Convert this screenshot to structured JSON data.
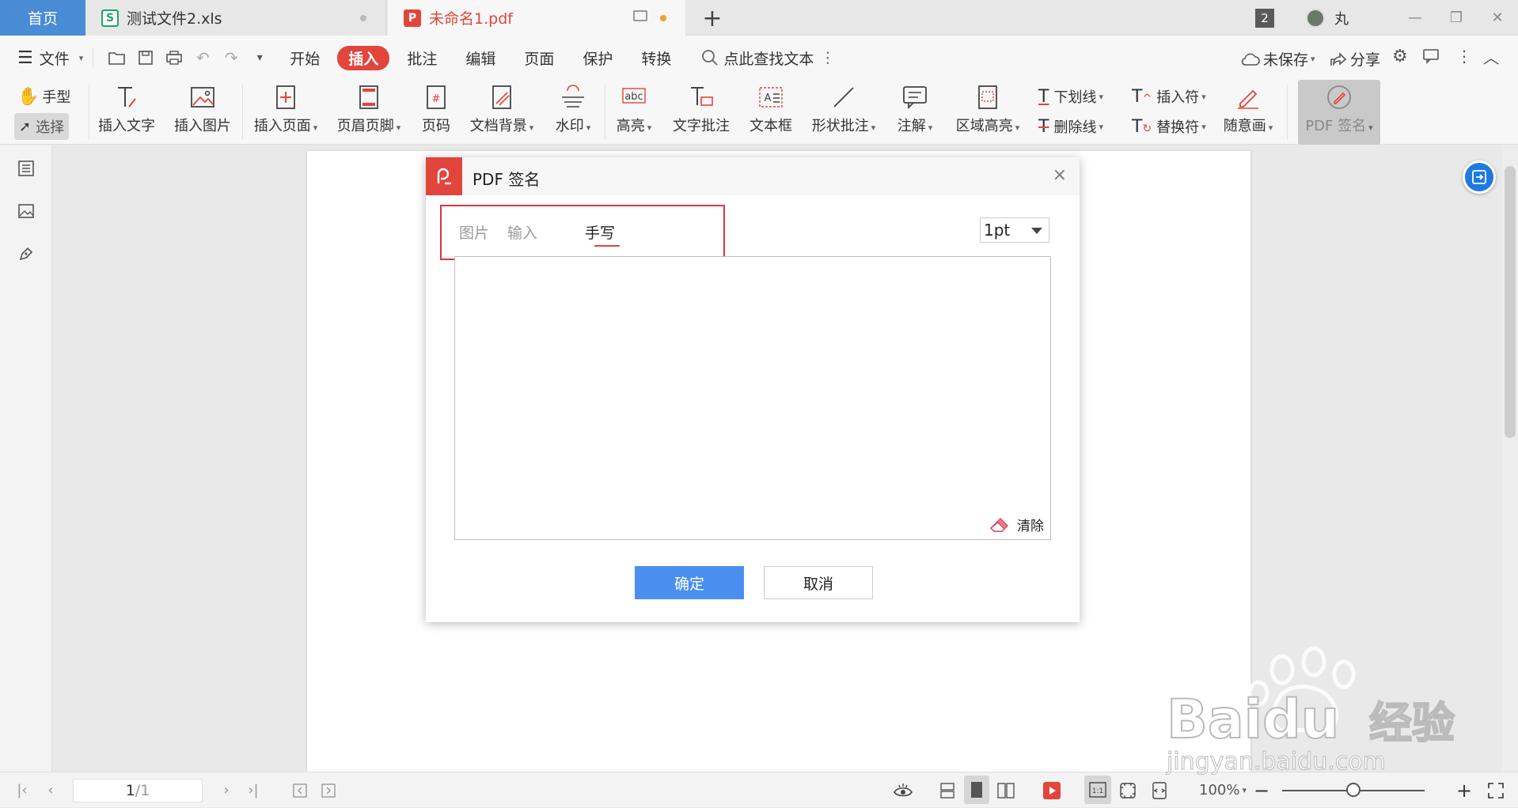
{
  "tabs": {
    "home": "首页",
    "file1": "测试文件2.xls",
    "file2": "未命名1.pdf",
    "window_count": "2",
    "user": "丸"
  },
  "menu": {
    "file": "文件",
    "items": [
      "开始",
      "插入",
      "批注",
      "编辑",
      "页面",
      "保护",
      "转换"
    ],
    "active": "插入",
    "search": "点此查找文本",
    "unsaved": "未保存",
    "share": "分享"
  },
  "ribbon": {
    "hand": "手型",
    "select": "选择",
    "insert_text": "插入文字",
    "insert_image": "插入图片",
    "insert_page": "插入页面",
    "header_footer": "页眉页脚",
    "page_number": "页码",
    "background": "文档背景",
    "watermark": "水印",
    "highlight": "高亮",
    "text_comment": "文字批注",
    "text_box": "文本框",
    "shape_comment": "形状批注",
    "note": "注解",
    "area_highlight": "区域高亮",
    "underline": "下划线",
    "strikethrough": "删除线",
    "insert_mark": "插入符",
    "replace_mark": "替换符",
    "freehand": "随意画",
    "pdf_sign": "PDF 签名"
  },
  "dialog": {
    "title": "PDF 签名",
    "tabs": [
      "图片",
      "输入",
      "手写"
    ],
    "active_tab": "手写",
    "pen_size": "1pt",
    "clear": "清除",
    "ok": "确定",
    "cancel": "取消"
  },
  "status": {
    "page_current": "1",
    "page_total": "1",
    "zoom": "100%",
    "zoom_level": 0.5
  },
  "watermark_text": {
    "brand": "Baidu",
    "cn": "经验",
    "url": "jingyan.baidu.com"
  },
  "colors": {
    "accent_red": "#e2453c",
    "primary_blue": "#4a8ff0",
    "home_tab_blue": "#4a8bd6",
    "xls_green": "#1fa463"
  }
}
